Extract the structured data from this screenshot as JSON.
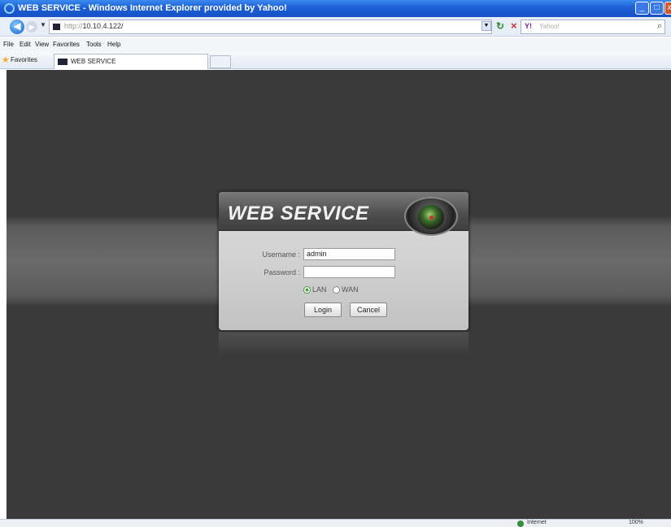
{
  "window": {
    "title": "WEB SERVICE - Windows Internet Explorer provided by Yahoo!",
    "minimize": "_",
    "maximize": "□",
    "close": "x"
  },
  "address": {
    "protocol": "http://",
    "host": "10.10.4.122/",
    "search_placeholder": "Yahoo!",
    "search_brand": "Y!"
  },
  "menu": [
    "File",
    "Edit",
    "View",
    "Favorites",
    "Tools",
    "Help"
  ],
  "favorites": {
    "label": "Favorites",
    "tab_title": "WEB SERVICE"
  },
  "login": {
    "title": "WEB SERVICE",
    "username_label": "Username :",
    "username_value": "admin",
    "password_label": "Password :",
    "password_value": "",
    "radio_options": [
      {
        "label": "LAN",
        "selected": true
      },
      {
        "label": "WAN",
        "selected": false
      }
    ],
    "login_button": "Login",
    "cancel_button": "Cancel"
  },
  "status": {
    "zone": "Internet",
    "zoom": "100%"
  },
  "colors": {
    "titlebar": "#1c5fd6",
    "page_bg": "#3a3a3a",
    "panel": "#d4d4d4"
  }
}
